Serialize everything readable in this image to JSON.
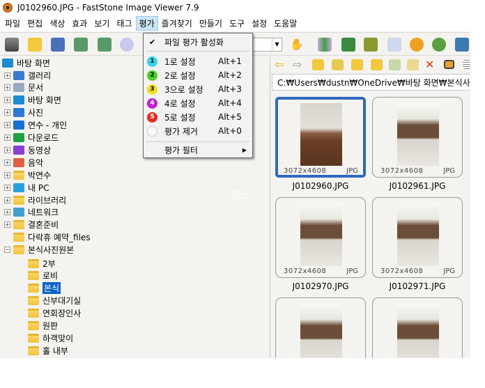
{
  "window": {
    "title": "J0102960.JPG  -  FastStone Image Viewer 7.9"
  },
  "menubar": [
    "파일",
    "편집",
    "색상",
    "효과",
    "보기",
    "태그",
    "평가",
    "즐겨찾기",
    "만들기",
    "도구",
    "설정",
    "도움말"
  ],
  "rating_menu": {
    "enable": "파일 평가 활성화",
    "items": [
      {
        "label": "1로 설정",
        "shortcut": "Alt+1",
        "num": "1",
        "color": "#2fd8e8"
      },
      {
        "label": "2로 설정",
        "shortcut": "Alt+2",
        "num": "2",
        "color": "#4cd020"
      },
      {
        "label": "3으로 설정",
        "shortcut": "Alt+3",
        "num": "3",
        "color": "#f2e020"
      },
      {
        "label": "4로 설정",
        "shortcut": "Alt+4",
        "num": "4",
        "color": "#c020d0"
      },
      {
        "label": "5로 설정",
        "shortcut": "Alt+5",
        "num": "5",
        "color": "#e03020"
      },
      {
        "label": "평가 제거",
        "shortcut": "Alt+0",
        "num": "",
        "color": "#f8f8f8"
      }
    ],
    "filter": "평가 필터"
  },
  "tree": {
    "root": "바탕 화면",
    "items": [
      "갤러리",
      "문서",
      "바탕 화면",
      "사진",
      "연수 - 개인",
      "다운로드",
      "동영상",
      "음악",
      "박연수",
      "내 PC",
      "라이브러리",
      "네트워크",
      "결혼준비",
      "다락휴 예약_files",
      "본식사진원본"
    ],
    "children": [
      "2부",
      "로비",
      "본식",
      "신부대기실",
      "연회장인사",
      "원판",
      "하객맞이",
      "홀 내부"
    ],
    "selected": "본식"
  },
  "path": "C:₩Users₩dustn₩OneDrive₩바탕 화면₩본식사진원본",
  "thumbnails": [
    {
      "name": "J0102960.JPG",
      "dims": "3072x4608",
      "ext": "JPG"
    },
    {
      "name": "J0102961.JPG",
      "dims": "3072x4608",
      "ext": "JPG"
    },
    {
      "name": "J0102970.JPG",
      "dims": "3072x4608",
      "ext": "JPG"
    },
    {
      "name": "J0102971.JPG",
      "dims": "3072x4608",
      "ext": "JPG"
    },
    {
      "name": "",
      "dims": "",
      "ext": ""
    },
    {
      "name": "",
      "dims": "",
      "ext": ""
    }
  ],
  "watermark": "얀스"
}
